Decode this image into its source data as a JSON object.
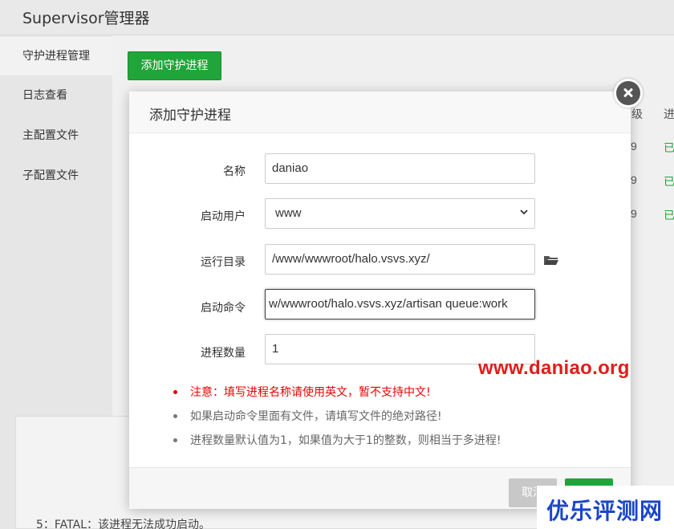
{
  "app": {
    "title": "Supervisor管理器"
  },
  "sidebar": {
    "items": [
      {
        "label": "守护进程管理",
        "active": true
      },
      {
        "label": "日志查看",
        "active": false
      },
      {
        "label": "主配置文件",
        "active": false
      },
      {
        "label": "子配置文件",
        "active": false
      }
    ]
  },
  "main": {
    "add_button": "添加守护进程",
    "table_peek": {
      "headers": [
        "级",
        "进"
      ],
      "rows": [
        [
          "9",
          "已"
        ],
        [
          "9",
          "已"
        ],
        [
          "9",
          "已"
        ]
      ]
    },
    "status_note": "5：FATAL：该进程无法成功启动。"
  },
  "modal": {
    "title": "添加守护进程",
    "fields": {
      "name": {
        "label": "名称",
        "value": "daniao"
      },
      "user": {
        "label": "启动用户",
        "value": "www"
      },
      "dir": {
        "label": "运行目录",
        "value": "/www/wwwroot/halo.vsvs.xyz/"
      },
      "command": {
        "label": "启动命令",
        "value": "w/wwwroot/halo.vsvs.xyz/artisan queue:work"
      },
      "count": {
        "label": "进程数量",
        "value": "1"
      }
    },
    "notes": [
      {
        "text": "注意：填写进程名称请使用英文，暂不支持中文!",
        "warn": true
      },
      {
        "text": "如果启动命令里面有文件，请填写文件的绝对路径!",
        "warn": false
      },
      {
        "text": "进程数量默认值为1，如果值为大于1的整数，则相当于多进程!",
        "warn": false
      }
    ],
    "cancel_label": "取消",
    "confirm_label": ""
  },
  "watermarks": {
    "url": "www.daniao.org",
    "logo": "优乐评测网"
  },
  "colors": {
    "accent_green": "#20a53a",
    "warning_red": "#e00000",
    "watermark_red": "#e31b1b",
    "watermark_blue": "#1b46c8"
  },
  "icons": {
    "close": "close-icon",
    "select_arrow": "chevron-down-icon",
    "folder": "folder-open-icon"
  }
}
